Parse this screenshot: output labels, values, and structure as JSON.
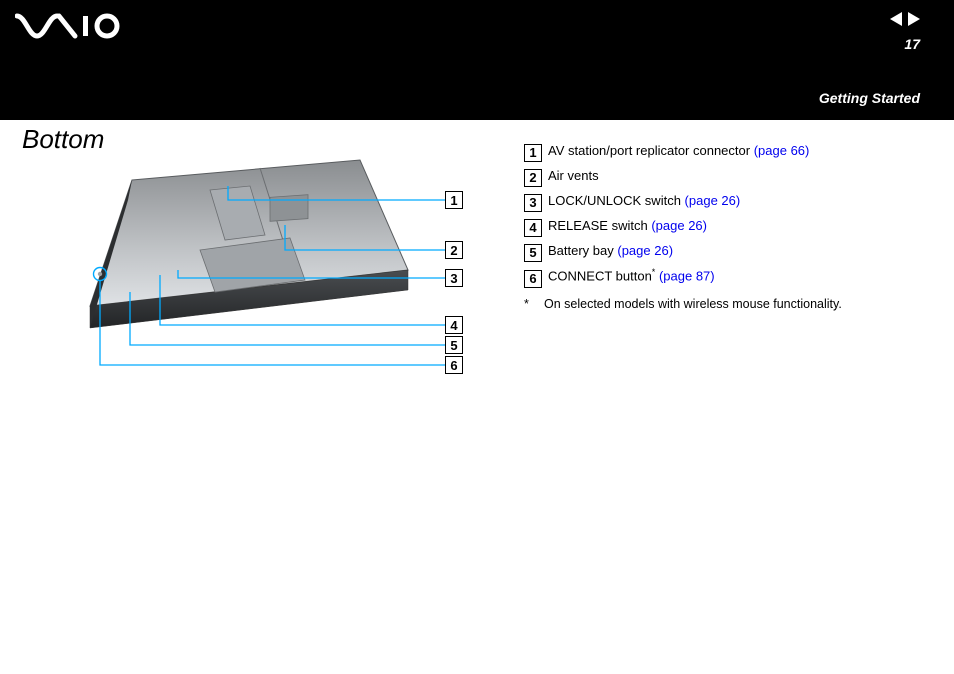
{
  "header": {
    "page_number": "17",
    "chapter": "Getting Started",
    "logo_alt": "VAIO"
  },
  "title": "Bottom",
  "callouts": {
    "n1": "1",
    "n2": "2",
    "n3": "3",
    "n4": "4",
    "n5": "5",
    "n6": "6"
  },
  "legend": {
    "items": [
      {
        "num": "1",
        "text": "AV station/port replicator connector ",
        "link": "(page 66)"
      },
      {
        "num": "2",
        "text": "Air vents",
        "link": ""
      },
      {
        "num": "3",
        "text": "LOCK/UNLOCK switch ",
        "link": "(page 26)"
      },
      {
        "num": "4",
        "text": "RELEASE switch ",
        "link": "(page 26)"
      },
      {
        "num": "5",
        "text": "Battery bay ",
        "link": "(page 26)"
      },
      {
        "num": "6",
        "text": "CONNECT button",
        "sup": "*",
        "post": " ",
        "link": "(page 87)"
      }
    ],
    "footnote_mark": "*",
    "footnote": "On selected models with wireless mouse functionality."
  }
}
